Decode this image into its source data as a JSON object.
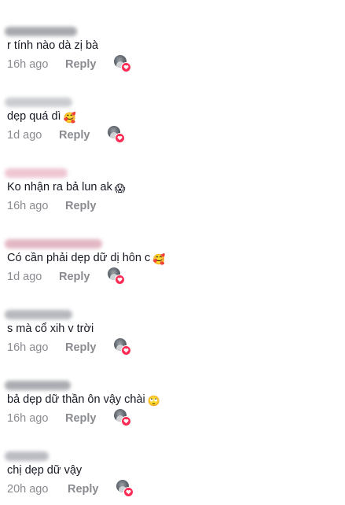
{
  "comments": [
    {
      "text": "r tính nào dà zị bà",
      "time": "16h ago",
      "reply": "Reply",
      "emoji": "",
      "username_tint": "#8a8d95"
    },
    {
      "text": "dẹp quá dì",
      "time": "1d ago",
      "reply": "Reply",
      "emoji": "🥰",
      "username_tint": "#b9bcc2"
    },
    {
      "text": "Ko nhận ra bả lun ak",
      "time": "16h ago",
      "reply": "Reply",
      "emoji": "😱",
      "username_tint": "#e8b4c4"
    },
    {
      "text": "Có cần phải dẹp dữ dị hôn c",
      "time": "1d ago",
      "reply": "Reply",
      "emoji": "🥰",
      "username_tint": "#d9a0b0"
    },
    {
      "text": "s mà cổ xih v trời",
      "time": "16h ago",
      "reply": "Reply",
      "emoji": "",
      "username_tint": "#9ea1a8"
    },
    {
      "text": "bả dẹp dữ thần ôn vậy chài",
      "time": "16h ago",
      "reply": "Reply",
      "emoji": "🙄",
      "username_tint": "#8e9198"
    },
    {
      "text": "chị dẹp dữ vậy",
      "time": "20h ago",
      "reply": "Reply",
      "emoji": "",
      "username_tint": "#a3a6ad"
    }
  ],
  "creator_like_icon": "creator-liked-avatar-icon",
  "like_badge_icon": "heart-icon",
  "accent_color": "#fe2c55"
}
